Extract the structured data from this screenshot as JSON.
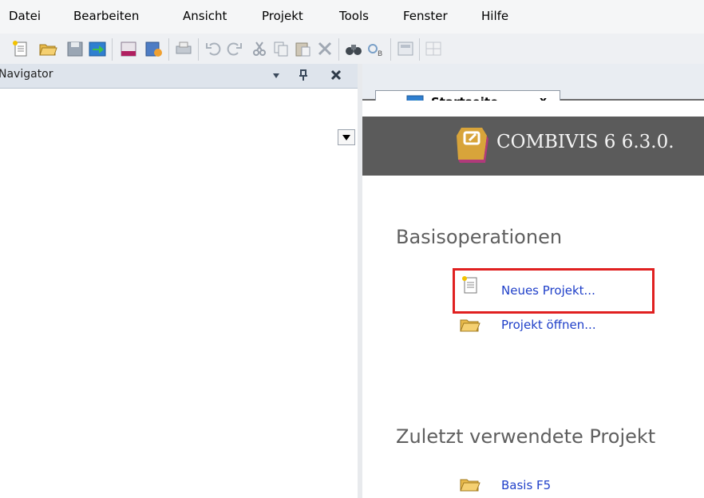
{
  "menu": [
    "Datei",
    "Bearbeiten",
    "Ansicht",
    "Projekt",
    "Tools",
    "Fenster",
    "Hilfe"
  ],
  "toolbar_icons": [
    "new-project-icon",
    "open-folder-icon",
    "save-icon",
    "import-icon",
    "keb-icon",
    "database-icon",
    "print-icon",
    "undo-icon",
    "redo-icon",
    "cut-icon",
    "copy-icon",
    "paste-icon",
    "delete-icon",
    "find-icon",
    "replace-icon",
    "layout-icon",
    "grid-icon"
  ],
  "navigator": {
    "title": "Navigator"
  },
  "tab": {
    "label": "Startseite",
    "close": "x"
  },
  "banner": {
    "title": "COMBIVIS 6 6.3.0."
  },
  "start": {
    "basis_heading": "Basisoperationen",
    "new_project": "Neues Projekt...",
    "open_project": "Projekt öffnen...",
    "recent_heading": "Zuletzt verwendete Projekt",
    "recent_item": "Basis F5"
  },
  "colors": {
    "link": "#1f3fc9",
    "highlight": "#e02020",
    "banner": "#5b5b5b"
  }
}
